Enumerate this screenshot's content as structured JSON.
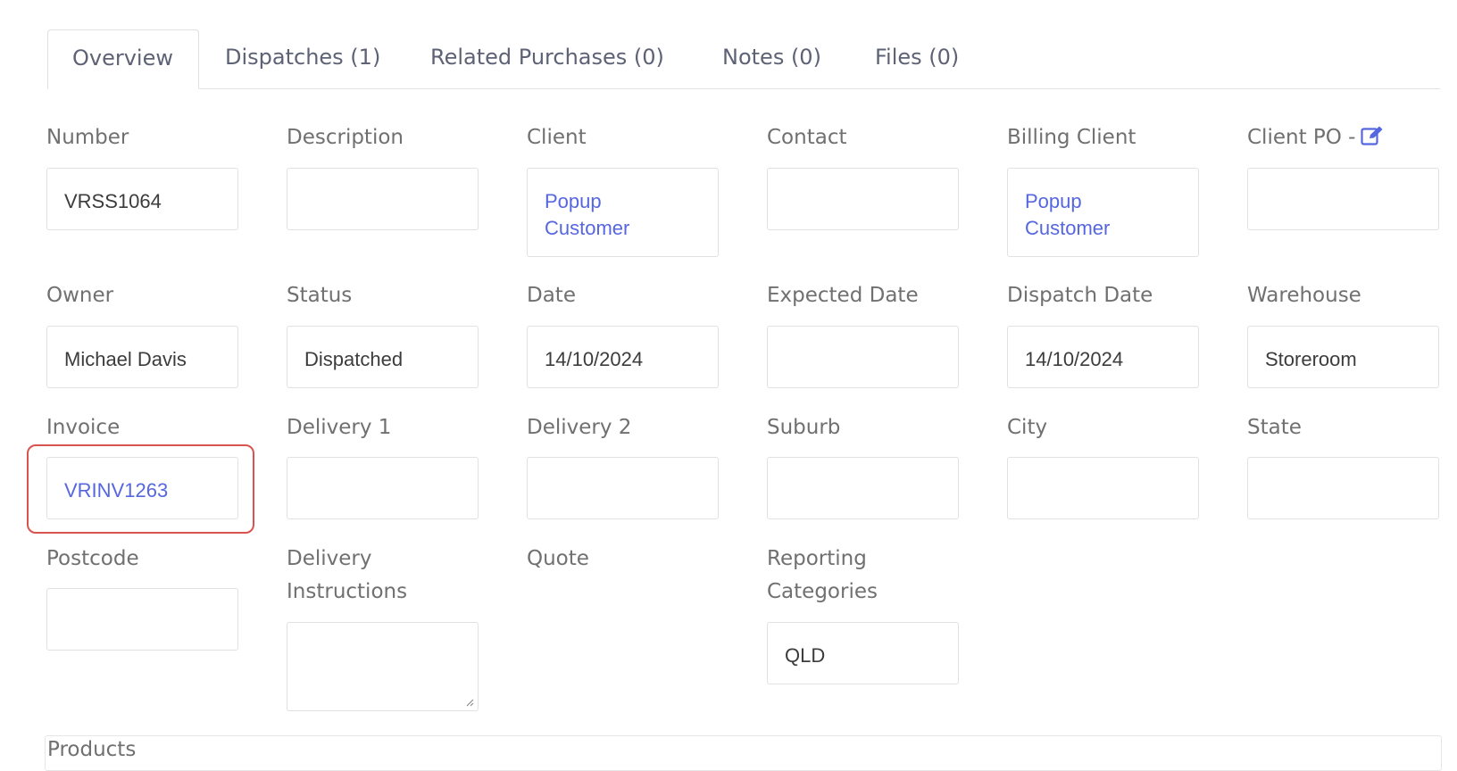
{
  "tabs": [
    {
      "label": "Overview",
      "active": true
    },
    {
      "label": "Dispatches (1)",
      "active": false
    },
    {
      "label": "Related Purchases (0)",
      "active": false
    },
    {
      "label": "Notes (0)",
      "active": false
    },
    {
      "label": "Files (0)",
      "active": false
    }
  ],
  "fields": {
    "number": {
      "label": "Number",
      "value": "VRSS1064"
    },
    "description": {
      "label": "Description",
      "value": ""
    },
    "client": {
      "label": "Client",
      "value": "Popup Customer"
    },
    "contact": {
      "label": "Contact",
      "value": ""
    },
    "billing_client": {
      "label": "Billing Client",
      "value": "Popup Customer"
    },
    "client_po": {
      "label": "Client PO -",
      "value": "",
      "icon": "edit-icon"
    },
    "owner": {
      "label": "Owner",
      "value": "Michael Davis"
    },
    "status": {
      "label": "Status",
      "value": "Dispatched"
    },
    "date": {
      "label": "Date",
      "value": "14/10/2024"
    },
    "expected_date": {
      "label": "Expected Date",
      "value": ""
    },
    "dispatch_date": {
      "label": "Dispatch Date",
      "value": "14/10/2024"
    },
    "warehouse": {
      "label": "Warehouse",
      "value": "Storeroom"
    },
    "invoice": {
      "label": "Invoice",
      "value": "VRINV1263"
    },
    "delivery1": {
      "label": "Delivery 1",
      "value": ""
    },
    "delivery2": {
      "label": "Delivery 2",
      "value": ""
    },
    "suburb": {
      "label": "Suburb",
      "value": ""
    },
    "city": {
      "label": "City",
      "value": ""
    },
    "state": {
      "label": "State",
      "value": ""
    },
    "postcode": {
      "label": "Postcode",
      "value": ""
    },
    "delivery_instructions": {
      "label": "Delivery Instructions",
      "value": ""
    },
    "quote": {
      "label": "Quote",
      "value": ""
    },
    "reporting_categories": {
      "label": "Reporting Categories",
      "value": "QLD"
    }
  },
  "products": {
    "title": "Products"
  },
  "colors": {
    "link": "#5566e0",
    "highlight": "#d9534f",
    "border": "#e1e1e1"
  }
}
